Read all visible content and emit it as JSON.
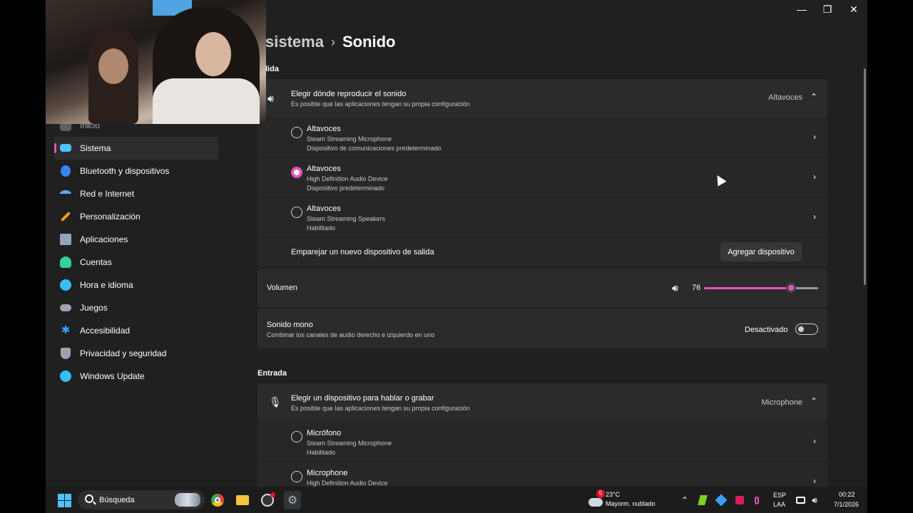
{
  "window": {
    "breadcrumb_parent": "sistema",
    "breadcrumb_current": "Sonido"
  },
  "sidebar": {
    "items": [
      {
        "label": "Inicio",
        "icon": "home-icon",
        "color": "#8a8a8a"
      },
      {
        "label": "Sistema",
        "icon": "monitor-icon",
        "color": "#4cc2ff",
        "active": true
      },
      {
        "label": "Bluetooth y dispositivos",
        "icon": "bluetooth-icon",
        "color": "#3b82f6"
      },
      {
        "label": "Red e Internet",
        "icon": "wifi-icon",
        "color": "#60a5fa"
      },
      {
        "label": "Personalización",
        "icon": "brush-icon",
        "color": "#f59e0b"
      },
      {
        "label": "Aplicaciones",
        "icon": "apps-icon",
        "color": "#94a3b8"
      },
      {
        "label": "Cuentas",
        "icon": "person-icon",
        "color": "#34d399"
      },
      {
        "label": "Hora e idioma",
        "icon": "globe-clock-icon",
        "color": "#38bdf8"
      },
      {
        "label": "Juegos",
        "icon": "gamepad-icon",
        "color": "#9ca3af"
      },
      {
        "label": "Accesibilidad",
        "icon": "accessibility-icon",
        "color": "#3b9eff"
      },
      {
        "label": "Privacidad y seguridad",
        "icon": "shield-icon",
        "color": "#9ca3af"
      },
      {
        "label": "Windows Update",
        "icon": "update-icon",
        "color": "#38bdf8"
      }
    ]
  },
  "output": {
    "section_label": "lida",
    "chooser_title": "Elegir dónde reproducir el sonido",
    "chooser_sub": "Es posible que las aplicaciones tengan su propia configuración",
    "chooser_value": "Altavoces",
    "devices": [
      {
        "name": "Altavoces",
        "line1": "Steam Streaming Microphone",
        "line2": "Dispositivo de comunicaciones predeterminado",
        "selected": false
      },
      {
        "name": "Altavoces",
        "line1": "High Definition Audio Device",
        "line2": "Dispositivo predeterminado",
        "selected": true
      },
      {
        "name": "Altavoces",
        "line1": "Steam Streaming Speakers",
        "line2": "Habilitado",
        "selected": false
      }
    ],
    "pair_label": "Emparejar un nuevo dispositivo de salida",
    "add_device": "Agregar dispositivo",
    "volume_label": "Volumen",
    "volume_value": "76",
    "volume_fraction": 0.76,
    "mono_title": "Sonido mono",
    "mono_sub": "Combinar los canales de audio derecho e izquierdo en uno",
    "mono_state": "Desactivado"
  },
  "input": {
    "section_label": "Entrada",
    "chooser_title": "Elegir un dispositivo para hablar o grabar",
    "chooser_sub": "Es posible que las aplicaciones tengan su propia configuración",
    "chooser_value": "Microphone",
    "devices": [
      {
        "name": "Micrófono",
        "line1": "Steam Streaming Microphone",
        "line2": "Habilitado"
      },
      {
        "name": "Microphone",
        "line1": "High Definition Audio Device",
        "line2": ""
      }
    ]
  },
  "taskbar": {
    "search_placeholder": "Búsqueda",
    "weather_temp": "23°C",
    "weather_desc": "Mayorm. nublado",
    "weather_badge": "5",
    "lang_top": "ESP",
    "lang_bottom": "LAA",
    "time": "00:22",
    "date": "7/1/2026"
  },
  "colors": {
    "accent": "#e94fc1",
    "background": "#202020",
    "card": "#2b2b2b"
  }
}
